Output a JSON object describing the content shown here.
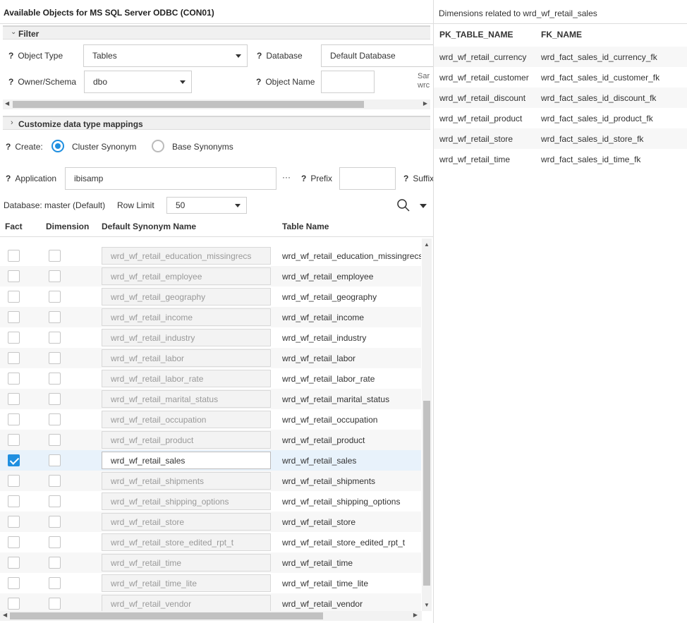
{
  "left": {
    "title": "Available Objects for MS SQL Server ODBC (CON01)",
    "filter": {
      "section_label": "Filter",
      "object_type_label": "Object Type",
      "object_type_value": "Tables",
      "database_label": "Database",
      "database_value": "Default Database",
      "owner_label": "Owner/Schema",
      "owner_value": "dbo",
      "object_name_label": "Object Name",
      "object_name_value": "",
      "cut_text_1": "Sar",
      "cut_text_2": "wrc"
    },
    "customize_label": "Customize data type mappings",
    "create": {
      "label": "Create:",
      "option_cluster": "Cluster Synonym",
      "option_base": "Base Synonyms",
      "selected": "Cluster Synonym"
    },
    "application_label": "Application",
    "application_value": "ibisamp",
    "ellipsis": "···",
    "prefix_label": "Prefix",
    "prefix_value": "",
    "suffix_label": "Suffix",
    "database_info": "Database: master (Default)",
    "row_limit_label": "Row Limit",
    "row_limit_value": "50",
    "q_mark": "?",
    "columns": {
      "fact": "Fact",
      "dimension": "Dimension",
      "synonym": "Default Synonym Name",
      "table": "Table Name"
    },
    "rows": [
      {
        "synonym": "wrd_wf_retail_education_missingrecs",
        "table": "wrd_wf_retail_education_missingrecs",
        "fact": false
      },
      {
        "synonym": "wrd_wf_retail_employee",
        "table": "wrd_wf_retail_employee",
        "fact": false
      },
      {
        "synonym": "wrd_wf_retail_geography",
        "table": "wrd_wf_retail_geography",
        "fact": false
      },
      {
        "synonym": "wrd_wf_retail_income",
        "table": "wrd_wf_retail_income",
        "fact": false
      },
      {
        "synonym": "wrd_wf_retail_industry",
        "table": "wrd_wf_retail_industry",
        "fact": false
      },
      {
        "synonym": "wrd_wf_retail_labor",
        "table": "wrd_wf_retail_labor",
        "fact": false
      },
      {
        "synonym": "wrd_wf_retail_labor_rate",
        "table": "wrd_wf_retail_labor_rate",
        "fact": false
      },
      {
        "synonym": "wrd_wf_retail_marital_status",
        "table": "wrd_wf_retail_marital_status",
        "fact": false
      },
      {
        "synonym": "wrd_wf_retail_occupation",
        "table": "wrd_wf_retail_occupation",
        "fact": false
      },
      {
        "synonym": "wrd_wf_retail_product",
        "table": "wrd_wf_retail_product",
        "fact": false
      },
      {
        "synonym": "wrd_wf_retail_sales",
        "table": "wrd_wf_retail_sales",
        "fact": true
      },
      {
        "synonym": "wrd_wf_retail_shipments",
        "table": "wrd_wf_retail_shipments",
        "fact": false
      },
      {
        "synonym": "wrd_wf_retail_shipping_options",
        "table": "wrd_wf_retail_shipping_options",
        "fact": false
      },
      {
        "synonym": "wrd_wf_retail_store",
        "table": "wrd_wf_retail_store",
        "fact": false
      },
      {
        "synonym": "wrd_wf_retail_store_edited_rpt_t",
        "table": "wrd_wf_retail_store_edited_rpt_t",
        "fact": false
      },
      {
        "synonym": "wrd_wf_retail_time",
        "table": "wrd_wf_retail_time",
        "fact": false
      },
      {
        "synonym": "wrd_wf_retail_time_lite",
        "table": "wrd_wf_retail_time_lite",
        "fact": false
      },
      {
        "synonym": "wrd_wf_retail_vendor",
        "table": "wrd_wf_retail_vendor",
        "fact": false
      }
    ]
  },
  "right": {
    "title": "Dimensions related to wrd_wf_retail_sales",
    "columns": {
      "pk": "PK_TABLE_NAME",
      "fk": "FK_NAME"
    },
    "rows": [
      {
        "pk": "wrd_wf_retail_currency",
        "fk": "wrd_fact_sales_id_currency_fk"
      },
      {
        "pk": "wrd_wf_retail_customer",
        "fk": "wrd_fact_sales_id_customer_fk"
      },
      {
        "pk": "wrd_wf_retail_discount",
        "fk": "wrd_fact_sales_id_discount_fk"
      },
      {
        "pk": "wrd_wf_retail_product",
        "fk": "wrd_fact_sales_id_product_fk"
      },
      {
        "pk": "wrd_wf_retail_store",
        "fk": "wrd_fact_sales_id_store_fk"
      },
      {
        "pk": "wrd_wf_retail_time",
        "fk": "wrd_fact_sales_id_time_fk"
      }
    ]
  },
  "colors": {
    "accent": "#1f8fe0",
    "selected_row": "#e8f2fb"
  },
  "icons": [
    "chevron-down-icon",
    "chevron-right-icon",
    "search-icon",
    "caret-down-icon",
    "checkmark-icon"
  ]
}
